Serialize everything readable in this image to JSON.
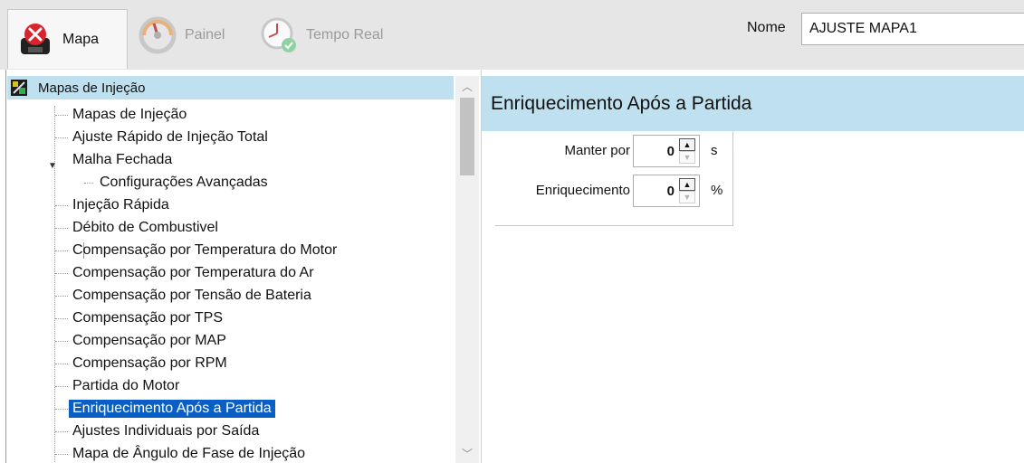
{
  "toolbar": {
    "tabs": [
      {
        "label": "Mapa",
        "icon": "mapa-icon",
        "active": true
      },
      {
        "label": "Painel",
        "icon": "gauge-icon",
        "active": false
      },
      {
        "label": "Tempo Real",
        "icon": "clock-icon",
        "active": false
      }
    ],
    "name_label": "Nome",
    "name_value": "AJUSTE MAPA1"
  },
  "tree": {
    "root": "Mapas de Injeção",
    "items": [
      {
        "label": "Mapas de Injeção",
        "level": 1
      },
      {
        "label": "Ajuste Rápido de Injeção Total",
        "level": 1
      },
      {
        "label": "Malha Fechada",
        "level": 1,
        "expanded": true
      },
      {
        "label": "Configurações Avançadas",
        "level": 2
      },
      {
        "label": "Injeção Rápida",
        "level": 1
      },
      {
        "label": "Débito de Combustivel",
        "level": 1
      },
      {
        "label": "Compensação por Temperatura do Motor",
        "level": 1
      },
      {
        "label": "Compensação por Temperatura do Ar",
        "level": 1
      },
      {
        "label": "Compensação por Tensão de Bateria",
        "level": 1
      },
      {
        "label": "Compensação por TPS",
        "level": 1
      },
      {
        "label": "Compensação por MAP",
        "level": 1
      },
      {
        "label": "Compensação por RPM",
        "level": 1
      },
      {
        "label": "Partida do Motor",
        "level": 1
      },
      {
        "label": "Enriquecimento Após a Partida",
        "level": 1,
        "selected": true
      },
      {
        "label": "Ajustes Individuais por Saída",
        "level": 1
      },
      {
        "label": "Mapa de Ângulo de Fase de Injeção",
        "level": 1
      }
    ]
  },
  "detail": {
    "title": "Enriquecimento Após a Partida",
    "fields": [
      {
        "label": "Manter por",
        "value": "0",
        "unit": "s"
      },
      {
        "label": "Enriquecimento",
        "value": "0",
        "unit": "%"
      }
    ]
  },
  "colors": {
    "header_bg": "#bfe0ef",
    "selection": "#0a5fc5",
    "toolbar_bg": "#e6e6e6"
  }
}
